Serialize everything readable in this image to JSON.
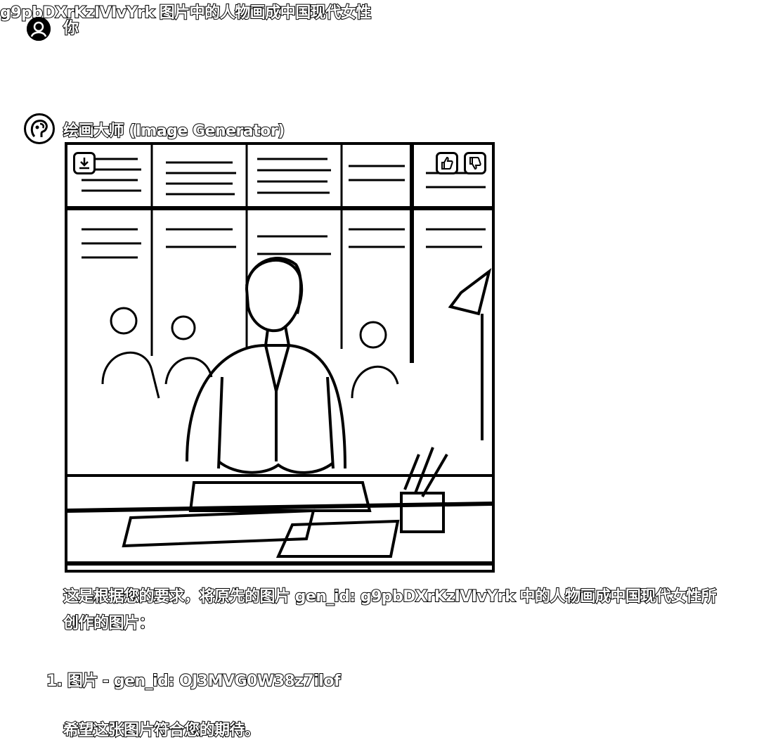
{
  "user": {
    "name": "你",
    "message": "g9pbDXrKzIVIvYrk 图片中的人物画成中国现代女性"
  },
  "bot": {
    "name": "绘画大师 (Image Generator)",
    "reply_text": "这是根据您的要求，将原先的图片 gen_id: g9pbDXrKzIVIvYrk 中的人物画成中国现代女性所创作的图片：",
    "list_items": [
      {
        "number": "1.",
        "label": "图片 - gen_id: OJ3MVG0W38z7ilof"
      }
    ],
    "closing": "希望这张图片符合您的期待。"
  },
  "icons": {
    "user_avatar": "user-avatar-icon",
    "bot_avatar": "bot-avatar-icon",
    "download": "download-icon",
    "like": "thumbs-up-icon",
    "dislike": "thumbs-down-icon"
  }
}
